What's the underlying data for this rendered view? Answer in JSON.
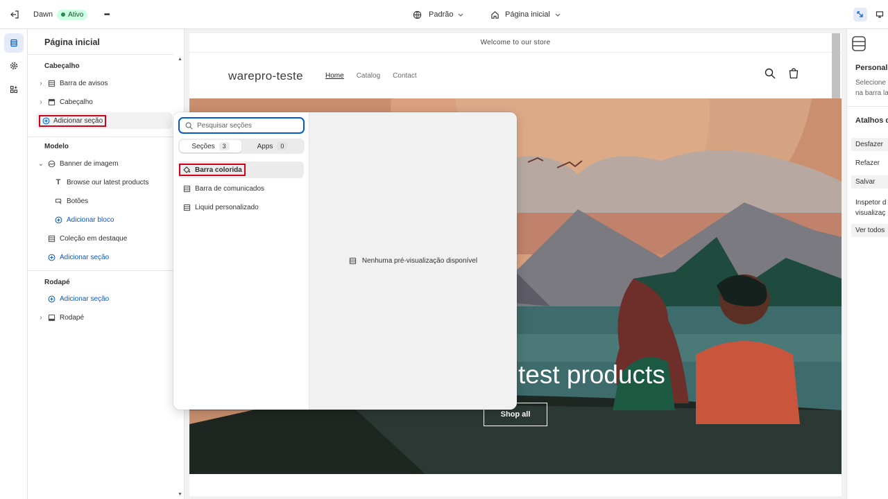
{
  "topbar": {
    "theme_name": "Dawn",
    "status_badge": "Ativo",
    "more_label": "•••",
    "theme_selector": "Padrão",
    "page_selector": "Página inicial"
  },
  "sidebar": {
    "title": "Página inicial",
    "header_group": {
      "label": "Cabeçalho",
      "items": [
        {
          "label": "Barra de avisos"
        },
        {
          "label": "Cabeçalho"
        }
      ],
      "add_section": "Adicionar seção"
    },
    "template_group": {
      "label": "Modelo",
      "banner": {
        "label": "Banner de imagem",
        "blocks": [
          {
            "label": "Browse our latest products"
          },
          {
            "label": "Botões"
          }
        ],
        "add_block": "Adicionar bloco"
      },
      "featured": {
        "label": "Coleção em destaque"
      },
      "add_section": "Adicionar seção"
    },
    "footer_group": {
      "label": "Rodapé",
      "add_section": "Adicionar seção",
      "items": [
        {
          "label": "Rodapé"
        }
      ]
    }
  },
  "popup": {
    "search_placeholder": "Pesquisar seções",
    "tabs": [
      {
        "label": "Seções",
        "count": "3"
      },
      {
        "label": "Apps",
        "count": "0"
      }
    ],
    "items": [
      {
        "label": "Barra colorida"
      },
      {
        "label": "Barra de comunicados"
      },
      {
        "label": "Liquid personalizado"
      }
    ],
    "no_preview": "Nenhuma pré-visualização disponível"
  },
  "preview": {
    "announcement": "Welcome to our store",
    "store_name": "warepro-teste",
    "nav": [
      "Home",
      "Catalog",
      "Contact"
    ],
    "hero_title": "test products",
    "shop_button": "Shop all"
  },
  "right_panel": {
    "title": "Personali",
    "desc_line1": "Selecione",
    "desc_line2": "na barra la",
    "shortcuts_title": "Atalhos d",
    "shortcuts": [
      "Desfazer",
      "Refazer",
      "Salvar"
    ],
    "inspector_line1": "Inspetor d",
    "inspector_line2": "visualizaç",
    "see_all": "Ver todos"
  },
  "colors": {
    "accent": "#005bd3",
    "highlight_box": "#d0021b",
    "badge_bg": "#cdfee1"
  }
}
